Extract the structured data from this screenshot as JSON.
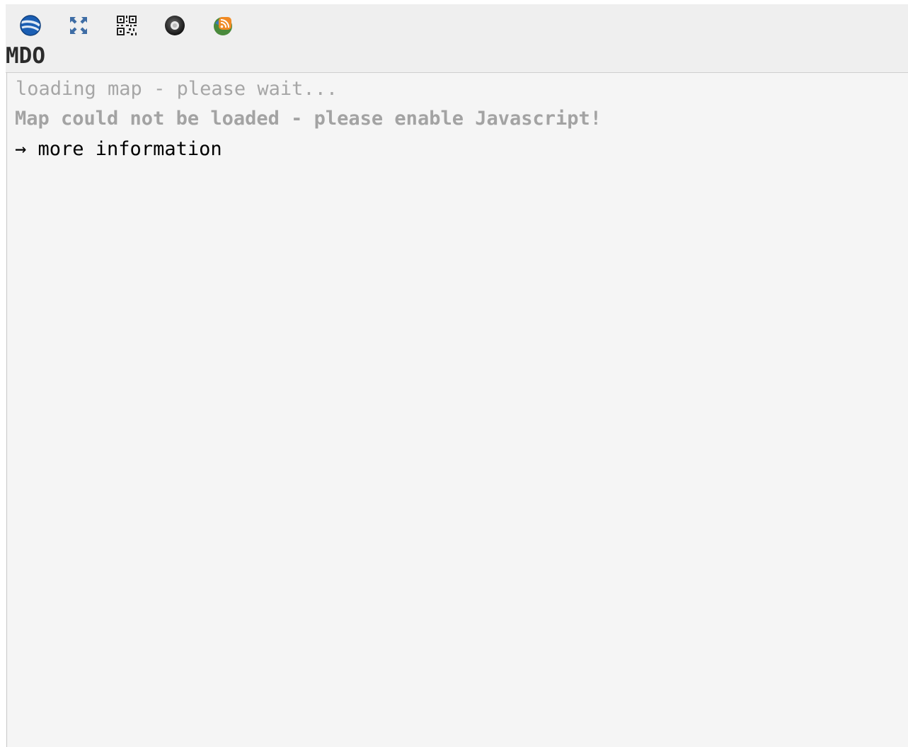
{
  "toolbar": {
    "icons": [
      {
        "name": "google-earth-icon"
      },
      {
        "name": "fullscreen-icon"
      },
      {
        "name": "qr-code-icon"
      },
      {
        "name": "wikitude-icon"
      },
      {
        "name": "georss-feed-icon"
      }
    ]
  },
  "header": {
    "title": "MDO"
  },
  "map": {
    "loading_text": "loading map - please wait...",
    "noscript_text": "Map could not be loaded - please enable Javascript!",
    "more_info_link": "→ more information"
  },
  "colors": {
    "header_bg": "#efefef",
    "map_bg": "#f5f5f5",
    "muted_text": "#a6a6a6",
    "title_text": "#2b2b2b"
  }
}
